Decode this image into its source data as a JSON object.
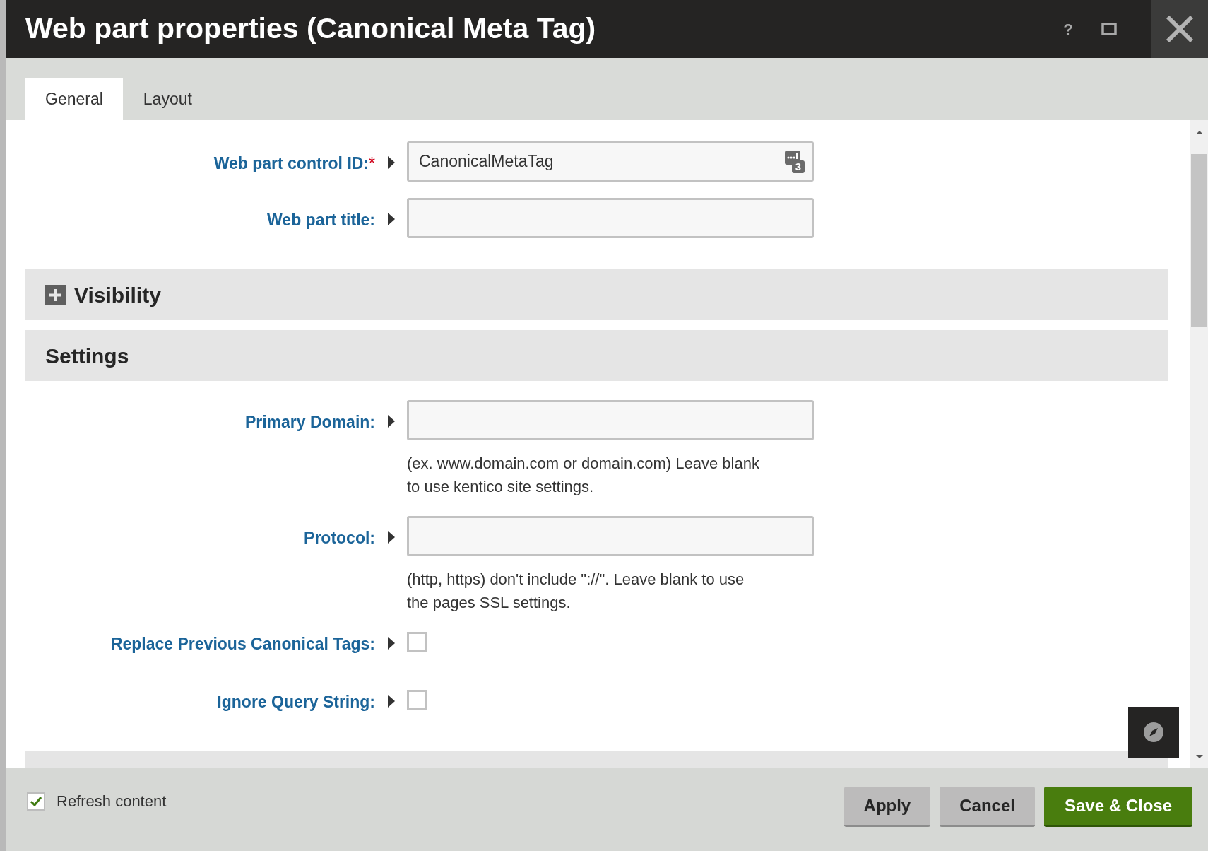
{
  "window": {
    "title": "Web part properties (Canonical Meta Tag)",
    "help": "?"
  },
  "tabs": [
    {
      "label": "General",
      "selected": true
    },
    {
      "label": "Layout",
      "selected": false
    }
  ],
  "top_fields": [
    {
      "kind": "text",
      "label": "Web part control ID:",
      "required_mark": "*",
      "value": "CanonicalMetaTag",
      "macro_badge": "3"
    },
    {
      "kind": "text",
      "label": "Web part title:"
    }
  ],
  "sections": [
    {
      "title": "Visibility",
      "expanded": false
    },
    {
      "title": "Settings",
      "expanded": true,
      "fields": [
        {
          "kind": "text",
          "label": "Primary Domain:",
          "hint": "(ex. www.domain.com or domain.com) Leave blank to use kentico site settings."
        },
        {
          "kind": "text",
          "label": "Protocol:",
          "hint": "(http, https) don't include \"://\". Leave blank to use the pages SSL settings."
        },
        {
          "kind": "checkbox",
          "label": "Replace Previous Canonical Tags:",
          "checked": false
        },
        {
          "kind": "checkbox",
          "label": "Ignore Query String:",
          "checked": false
        }
      ]
    }
  ],
  "footer": {
    "refresh_content": {
      "label": "Refresh content",
      "checked": true
    },
    "buttons": [
      {
        "label": "Apply",
        "kind": "secondary"
      },
      {
        "label": "Cancel",
        "kind": "secondary"
      },
      {
        "label": "Save & Close",
        "kind": "primary"
      }
    ]
  }
}
